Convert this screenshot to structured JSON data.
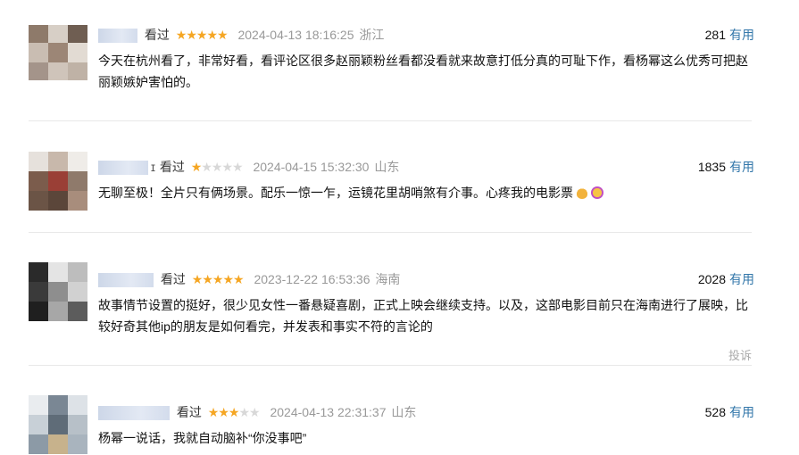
{
  "comments": [
    {
      "user_tail": "",
      "seen_label": "看过",
      "rating": 5,
      "time": "2024-04-13 18:16:25",
      "location": "浙江",
      "votes": "281",
      "useful_label": "有用",
      "content": "今天在杭州看了，非常好看，看评论区很多赵丽颖粉丝看都没看就来故意打低分真的可耻下作，看杨幂这么优秀可把赵丽颖嫉妒害怕的。"
    },
    {
      "user_tail": "ɪ",
      "seen_label": "看过",
      "rating": 1,
      "time": "2024-04-15 15:32:30",
      "location": "山东",
      "votes": "1835",
      "useful_label": "有用",
      "content": "无聊至极！全片只有俩场景。配乐一惊一乍，运镜花里胡哨煞有介事。心疼我的电影票"
    },
    {
      "user_tail": "",
      "seen_label": "看过",
      "rating": 5,
      "time": "2023-12-22 16:53:36",
      "location": "海南",
      "votes": "2028",
      "useful_label": "有用",
      "content": "故事情节设置的挺好，很少见女性一番悬疑喜剧，正式上映会继续支持。以及，这部电影目前只在海南进行了展映，比较好奇其他ip的朋友是如何看完，并发表和事实不符的言论的",
      "report_label": "投诉"
    },
    {
      "user_tail": "",
      "seen_label": "看过",
      "rating": 3,
      "time": "2024-04-13 22:31:37",
      "location": "山东",
      "votes": "528",
      "useful_label": "有用",
      "content": "杨幂一说话，我就自动脑补“你没事吧”"
    }
  ],
  "icons": {
    "star": "★",
    "emoji_1": "money-bag-icon",
    "emoji_2": "crying-face-icon"
  },
  "colors": {
    "star_on": "#f5a623",
    "star_off": "#d8d8d8",
    "useful_link": "#3377aa",
    "meta_gray": "#999999"
  }
}
